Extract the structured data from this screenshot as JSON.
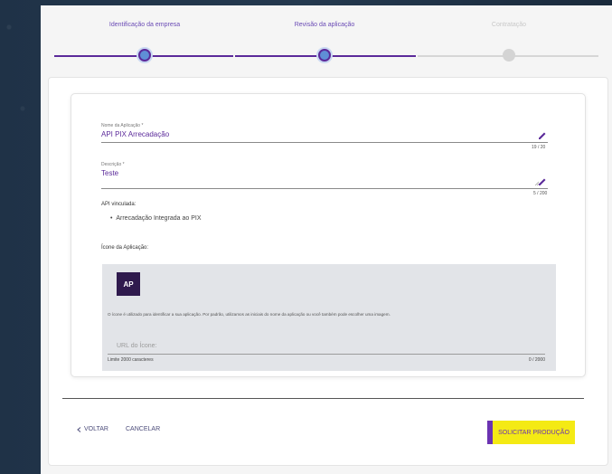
{
  "stepper": {
    "steps": [
      {
        "label": "Identificação da empresa",
        "state": "done"
      },
      {
        "label": "Revisão da aplicação",
        "state": "current"
      },
      {
        "label": "Contratação",
        "state": "pending"
      }
    ]
  },
  "form": {
    "name": {
      "label": "Nome da Aplicação *",
      "value": "API PIX Arrecadação",
      "counter": "19 / 20"
    },
    "description": {
      "label": "Descrição *",
      "value": "Teste",
      "counter": "5 / 200"
    },
    "linked_api_label": "API vinculada:",
    "linked_apis": [
      "Arrecadação Integrada ao PIX"
    ],
    "icon_section_label": "Ícone da Aplicação:",
    "icon": {
      "initials": "AP",
      "info": "O ícone é utilizado para identificar a sua aplicação. Por padrão, utilizamos as iniciais do nome da aplicação ou você também pode escolher uma imagem.",
      "url_label": "URL do Ícone:",
      "url_hint": "Limite 2000 caracteres",
      "url_counter": "0 / 2000"
    }
  },
  "footer": {
    "back_label": "VOLTAR",
    "cancel_label": "CANCELAR",
    "submit_label": "SOLICITAR PRODUÇÃO"
  },
  "colors": {
    "accent": "#5b2a9a",
    "submit_bg": "#f4ea14",
    "avatar_bg": "#2f1a4d"
  }
}
